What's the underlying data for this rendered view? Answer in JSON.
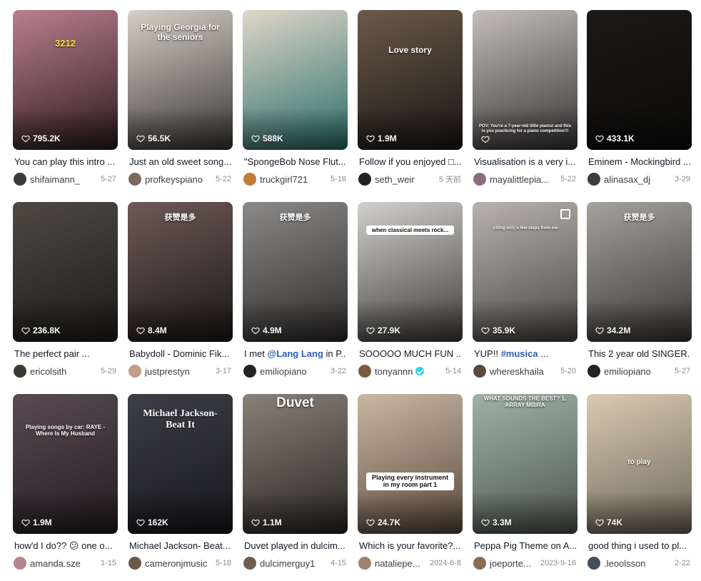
{
  "videos": [
    {
      "id": "v1",
      "likes": "795.2K",
      "desc": "You can play this intro ...",
      "tag": "",
      "desc_after": "",
      "user": "shifaimann_",
      "verified": false,
      "date": "5-27",
      "overlay": "3212",
      "bg": [
        "#b9808e",
        "#2c1a1d"
      ],
      "avatar_color": "#3b3b3b",
      "corner_icon": false
    },
    {
      "id": "v2",
      "likes": "56.5K",
      "desc": "Just an old sweet song...",
      "tag": "",
      "desc_after": "",
      "user": "profkeyspiano",
      "verified": false,
      "date": "5-22",
      "overlay": "Playing Georgia for the seniors",
      "bg": [
        "#d6d0c6",
        "#3a3733"
      ],
      "avatar_color": "#7a6a5e",
      "corner_icon": false
    },
    {
      "id": "v3",
      "likes": "588K",
      "desc": "\"SpongeBob Nose Flut...",
      "tag": "",
      "desc_after": "",
      "user": "truckgirl721",
      "verified": false,
      "date": "5-16",
      "overlay": "",
      "bg": [
        "#e0d6c8",
        "#2a6f6b"
      ],
      "avatar_color": "#c47a3a",
      "corner_icon": false
    },
    {
      "id": "v4",
      "likes": "1.9M",
      "desc": "Follow if you enjoyed □...",
      "tag": "",
      "desc_after": "",
      "user": "seth_weir",
      "verified": false,
      "date": "5 天前",
      "overlay": "Love story",
      "bg": [
        "#6b5a4a",
        "#1a1613"
      ],
      "avatar_color": "#222222",
      "corner_icon": false
    },
    {
      "id": "v5",
      "likes": "",
      "desc": "Visualisation is a very i...",
      "tag": "",
      "desc_after": "",
      "user": "mayalittlepia...",
      "verified": false,
      "date": "5-22",
      "overlay": "POV: You're a 7-year-old little pianist and this is you practicing for a piano competition!!!",
      "bg": [
        "#c4bfb8",
        "#363434"
      ],
      "avatar_color": "#8a6d7e",
      "corner_icon": false
    },
    {
      "id": "v6",
      "likes": "433.1K",
      "desc": "Eminem - Mockingbird ...",
      "tag": "",
      "desc_after": "",
      "user": "alinasax_dj",
      "verified": false,
      "date": "3-29",
      "overlay": "",
      "bg": [
        "#1c1a18",
        "#0b0a09"
      ],
      "avatar_color": "#3d3d3d",
      "corner_icon": false
    },
    {
      "id": "v7",
      "likes": "236.8K",
      "desc": "The perfect pair ...",
      "tag": "",
      "desc_after": "",
      "user": "ericolsith",
      "verified": false,
      "date": "5-29",
      "overlay": "",
      "bg": [
        "#4e4a42",
        "#1d1b18"
      ],
      "avatar_color": "#3a3a34",
      "corner_icon": false
    },
    {
      "id": "v8",
      "likes": "8.4M",
      "desc": "Babydoll - Dominic Fik...",
      "tag": "",
      "desc_after": "",
      "user": "justprestyn",
      "verified": false,
      "date": "3-17",
      "overlay": "获赞是多",
      "bg": [
        "#6e5a55",
        "#1b1716"
      ],
      "avatar_color": "#c49b8a",
      "corner_icon": false
    },
    {
      "id": "v9",
      "likes": "4.9M",
      "desc": "I met ",
      "tag": "@Lang Lang",
      "desc_after": " in P...",
      "user": "emiliopiano",
      "verified": false,
      "date": "3-22",
      "overlay": "获赞是多",
      "bg": [
        "#8c8a88",
        "#2e2c2b"
      ],
      "avatar_color": "#232323",
      "corner_icon": false
    },
    {
      "id": "v10",
      "likes": "27.9K",
      "desc": "SOOOOO MUCH FUN ...",
      "tag": "",
      "desc_after": "",
      "user": "tonyannn",
      "verified": true,
      "date": "5-14",
      "overlay": "when classical meets rock...",
      "bg": [
        "#d2d0cc",
        "#3f3d3a"
      ],
      "avatar_color": "#7a5a3e",
      "corner_icon": false
    },
    {
      "id": "v11",
      "likes": "35.9K",
      "desc": "YUP!! ",
      "tag": "#musica",
      "desc_after": " ...",
      "user": "whereskhaila",
      "verified": false,
      "date": "5-20",
      "overlay": "sitting only a few steps from me",
      "bg": [
        "#b8b3ae",
        "#4a4744"
      ],
      "avatar_color": "#5a4a42",
      "corner_icon": true
    },
    {
      "id": "v12",
      "likes": "34.2M",
      "desc": "This 2 year old SINGER...",
      "tag": "",
      "desc_after": "",
      "user": "emiliopiano",
      "verified": false,
      "date": "5-27",
      "overlay": "获赞是多",
      "bg": [
        "#a6a29c",
        "#3a3836"
      ],
      "avatar_color": "#232323",
      "corner_icon": false
    },
    {
      "id": "v13",
      "likes": "1.9M",
      "desc": "how'd I do?? 😕 one o...",
      "tag": "",
      "desc_after": "",
      "user": "amanda.sze",
      "verified": false,
      "date": "1-15",
      "overlay": "Playing songs by car: RAYE - Where Is My Husband",
      "bg": [
        "#5a4a52",
        "#231c20"
      ],
      "avatar_color": "#b3868f",
      "corner_icon": false
    },
    {
      "id": "v14",
      "likes": "162K",
      "desc": "Michael Jackson- Beat...",
      "tag": "",
      "desc_after": "",
      "user": "cameronjmusic",
      "verified": false,
      "date": "5-18",
      "overlay": "Michael Jackson- Beat It",
      "bg": [
        "#3e3f46",
        "#16171b"
      ],
      "avatar_color": "#6a5a4a",
      "corner_icon": false
    },
    {
      "id": "v15",
      "likes": "1.1M",
      "desc": "Duvet played in dulcim...",
      "tag": "",
      "desc_after": "",
      "user": "dulcimerguy1",
      "verified": false,
      "date": "4-15",
      "overlay": "Duvet",
      "bg": [
        "#8a8178",
        "#2a2622"
      ],
      "avatar_color": "#6e5e50",
      "corner_icon": false
    },
    {
      "id": "v16",
      "likes": "24.7K",
      "desc": "Which is your favorite?...",
      "tag": "",
      "desc_after": "",
      "user": "nataliepe...",
      "verified": false,
      "date": "2024-6-8",
      "overlay": "Playing every instrument in my room part 1",
      "bg": [
        "#c9b7a4",
        "#5b4a3c"
      ],
      "avatar_color": "#a08070",
      "corner_icon": false
    },
    {
      "id": "v17",
      "likes": "3.3M",
      "desc": "Peppa Pig Theme on A...",
      "tag": "",
      "desc_after": "",
      "user": "joeporte...",
      "verified": false,
      "date": "2023-9-16",
      "overlay": "WHAT SOUNDS THE BEST? 1. ARRAY MBIRA",
      "bg": [
        "#9fb3a3",
        "#4d5650"
      ],
      "avatar_color": "#8b6b52",
      "corner_icon": false
    },
    {
      "id": "v18",
      "likes": "74K",
      "desc": "good thing i used to pl...",
      "tag": "",
      "desc_after": "",
      "user": ".leoolsson",
      "verified": false,
      "date": "2-22",
      "overlay": "to play",
      "bg": [
        "#d9cbb3",
        "#6d6658"
      ],
      "avatar_color": "#44505a",
      "corner_icon": false
    }
  ]
}
